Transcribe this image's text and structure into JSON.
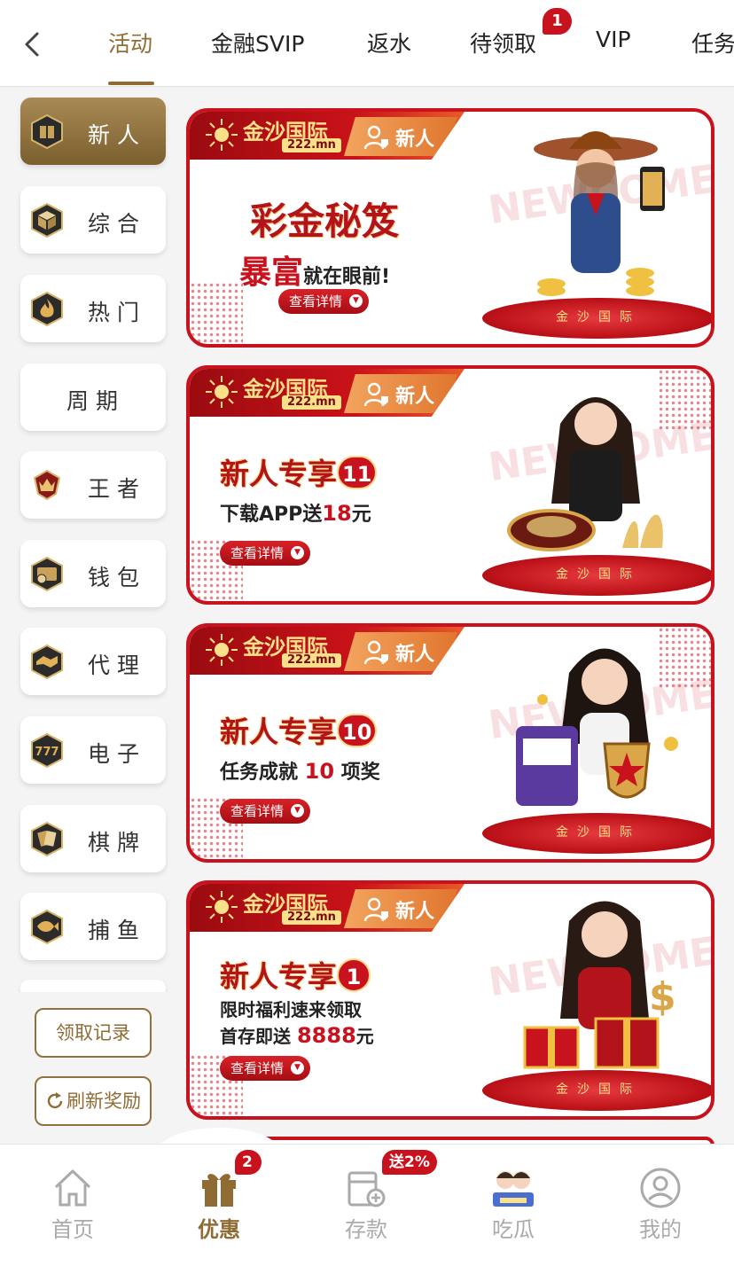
{
  "top_nav": {
    "tabs": [
      {
        "label": "活动",
        "active": true
      },
      {
        "label": "金融SVIP"
      },
      {
        "label": "返水"
      },
      {
        "label": "待领取",
        "badge": "1"
      },
      {
        "label": "VIP"
      },
      {
        "label": "任务"
      }
    ]
  },
  "sidebar": {
    "items": [
      {
        "label": "新人",
        "icon": "gift-box-icon",
        "active": true
      },
      {
        "label": "综合",
        "icon": "cube-icon"
      },
      {
        "label": "热门",
        "icon": "flame-icon"
      },
      {
        "label": "周期",
        "icon": ""
      },
      {
        "label": "王者",
        "icon": "crown-emblem-icon"
      },
      {
        "label": "钱包",
        "icon": "wallet-icon"
      },
      {
        "label": "代理",
        "icon": "handshake-icon"
      },
      {
        "label": "电子",
        "icon": "slot-777-icon"
      },
      {
        "label": "棋牌",
        "icon": "playing-cards-icon"
      },
      {
        "label": "捕鱼",
        "icon": "fish-icon"
      }
    ],
    "claim_record": "领取记录",
    "refresh_rewards": "刷新奖励"
  },
  "brand": {
    "name": "金沙国际",
    "url": "222.mn",
    "stage_text": "金沙国际",
    "watermark": "NEWCOMER"
  },
  "cards": [
    {
      "tag": "新人",
      "title": "彩金秘笈",
      "cursive": "暴富",
      "subtitle": "就在眼前!",
      "button": "查看详情"
    },
    {
      "tag": "新人",
      "title": "新人专享",
      "number": "11",
      "line1_prefix": "下载APP送",
      "line1_highlight": "18",
      "line1_suffix": "元",
      "button": "查看详情"
    },
    {
      "tag": "新人",
      "title": "新人专享",
      "number": "10",
      "line1_prefix": "任务成就 ",
      "line1_highlight": "10",
      "line1_suffix": " 项奖",
      "button": "查看详情"
    },
    {
      "tag": "新人",
      "title": "新人专享",
      "number": "1",
      "line1": "限时福利速来领取",
      "line2_prefix": "首存即送 ",
      "line2_highlight": "8888",
      "line2_suffix": "元",
      "button": "查看详情"
    }
  ],
  "bottom_nav": {
    "items": [
      {
        "label": "首页",
        "icon": "home-icon"
      },
      {
        "label": "优惠",
        "icon": "gift-icon",
        "active": true,
        "badge": "2"
      },
      {
        "label": "存款",
        "icon": "deposit-icon",
        "badge": "送2%"
      },
      {
        "label": "吃瓜",
        "icon": "promo-avatar-icon"
      },
      {
        "label": "我的",
        "icon": "profile-icon"
      }
    ]
  },
  "colors": {
    "accent_gold": "#8f6c34",
    "brand_red": "#c8121d",
    "gold_text": "#fbe08a"
  }
}
